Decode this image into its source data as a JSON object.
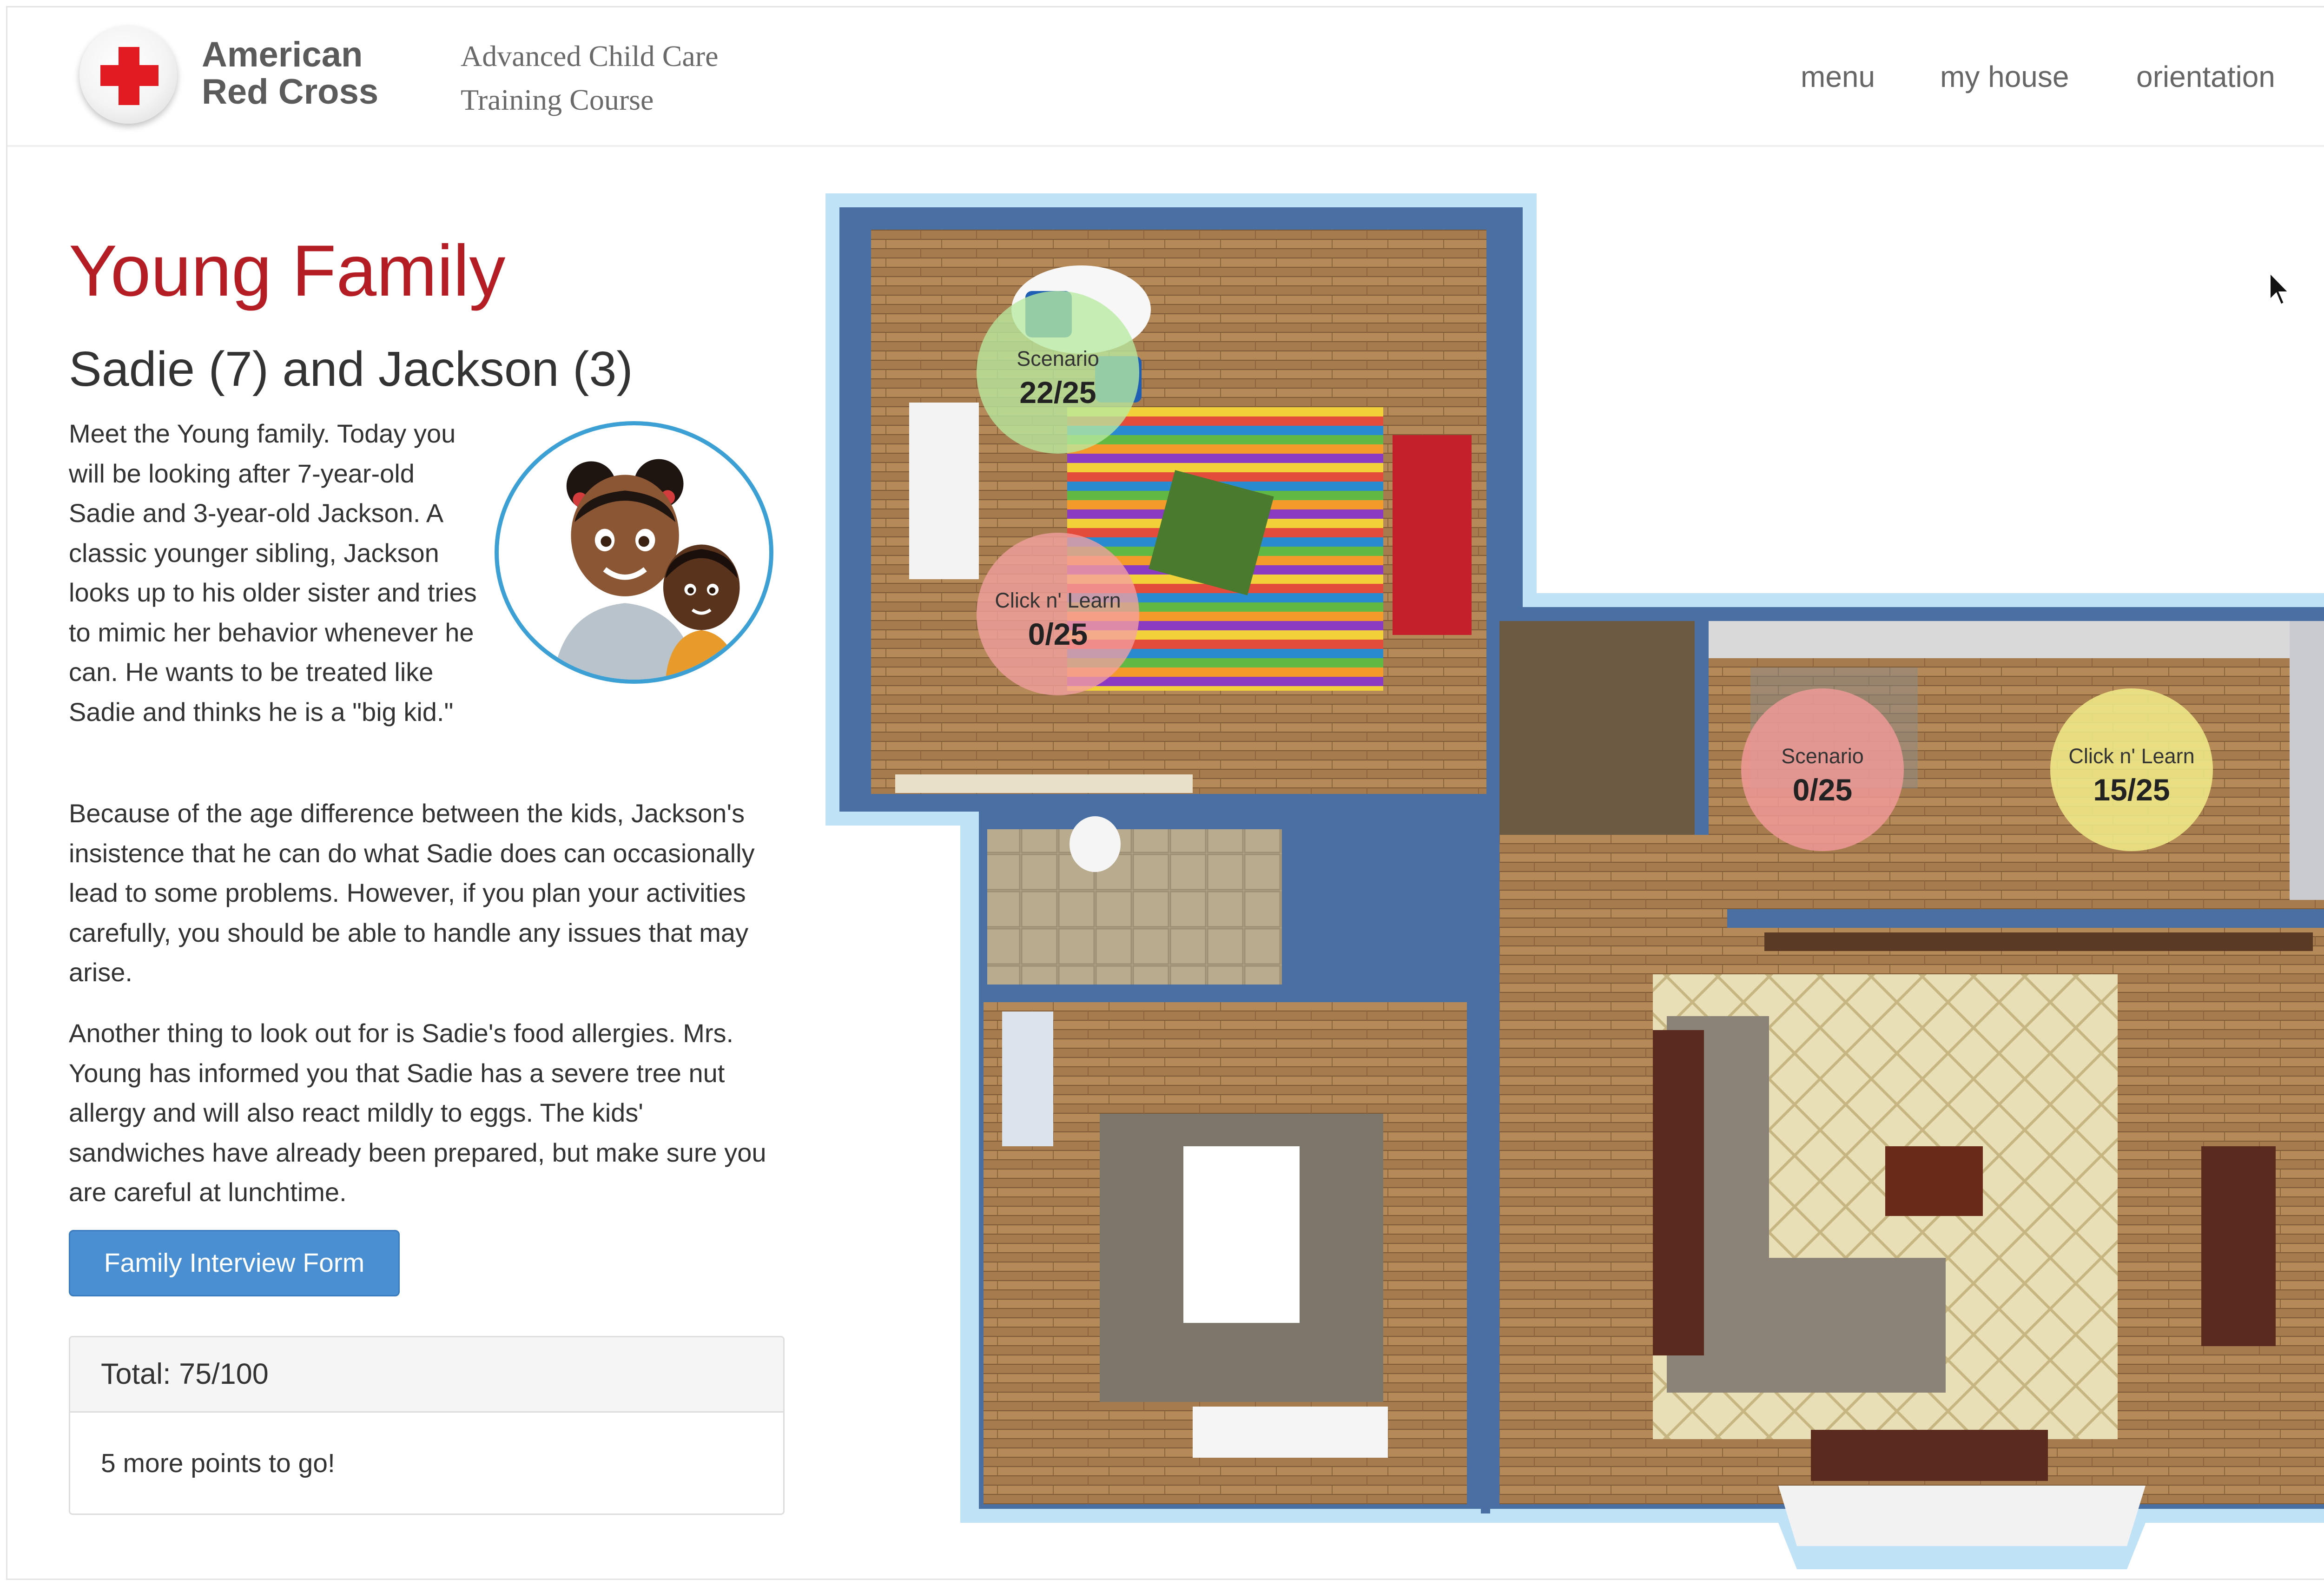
{
  "header": {
    "brand_line1": "American",
    "brand_line2": "Red Cross",
    "course_line1": "Advanced Child Care",
    "course_line2": "Training Course",
    "nav": [
      "menu",
      "my house",
      "orientation"
    ]
  },
  "family": {
    "title": "Young Family",
    "subtitle": "Sadie (7) and Jackson (3)",
    "paragraphs": [
      "Meet the Young family. Today you will be looking after 7-year-old Sadie and 3-year-old Jackson. A classic younger sibling, Jackson looks up to his older sister and tries to mimic her behavior whenever he can. He wants to be treated like Sadie and thinks he is a \"big kid.\"",
      "Because of the age difference between the kids, Jackson's insistence that he can do what Sadie does can occasionally lead to some problems. However, if you plan your activities carefully, you should be able to handle any issues that may arise.",
      "Another thing to look out for is Sadie's food allergies. Mrs. Young has informed you that Sadie has a severe tree nut allergy and will also react mildly to eggs. The kids' sandwiches have already been prepared, but make sure you are careful at lunchtime."
    ],
    "button_label": "Family Interview Form"
  },
  "score": {
    "total_label": "Total: 75/100",
    "remaining": "5 more points to go!"
  },
  "hotspots": [
    {
      "label": "Scenario",
      "value": "22/25",
      "room": "bedroom",
      "color": "#b9eaa0"
    },
    {
      "label": "Click n' Learn",
      "value": "0/25",
      "room": "bedroom",
      "color": "#f4a0a0"
    },
    {
      "label": "Scenario",
      "value": "0/25",
      "room": "kitchen",
      "color": "#f29a9a"
    },
    {
      "label": "Click n' Learn",
      "value": "15/25",
      "room": "kitchen",
      "color": "#f2ef8a"
    }
  ],
  "colors": {
    "title_red": "#b41d24",
    "button_blue": "#4a8fd2",
    "avatar_ring": "#3da0d5",
    "cross_red": "#e21b23"
  }
}
